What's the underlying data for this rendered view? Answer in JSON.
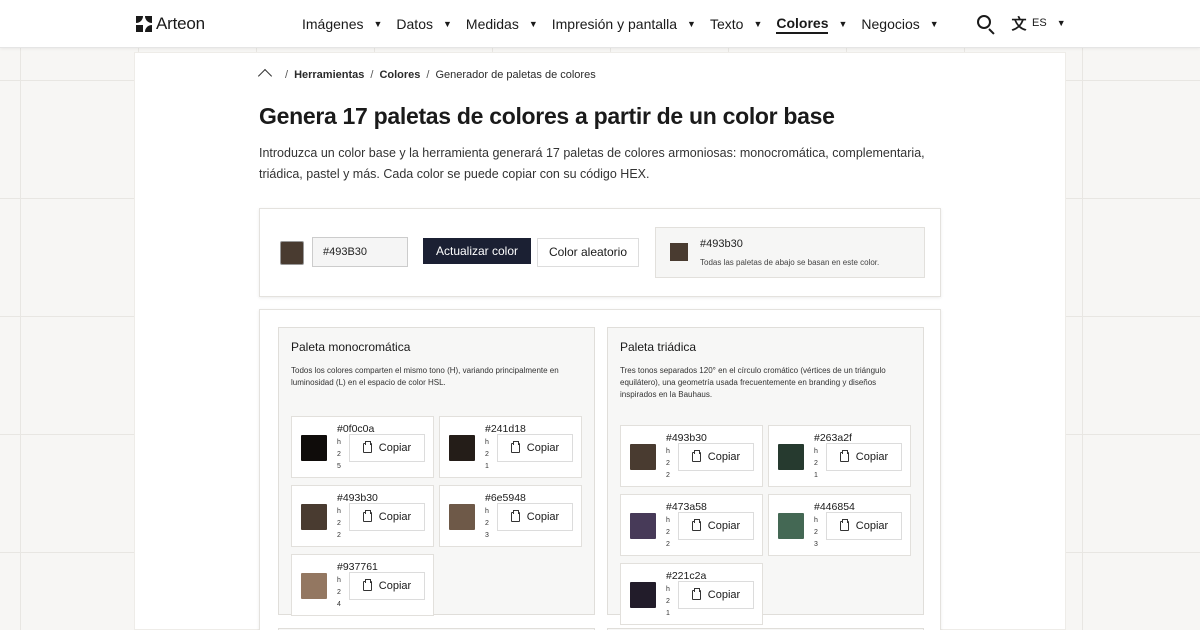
{
  "nav": {
    "brand": "Arteon",
    "menu": [
      {
        "label": "Imágenes",
        "active": false
      },
      {
        "label": "Datos",
        "active": false
      },
      {
        "label": "Medidas",
        "active": false
      },
      {
        "label": "Impresión y pantalla",
        "active": false
      },
      {
        "label": "Texto",
        "active": false
      },
      {
        "label": "Colores",
        "active": true
      },
      {
        "label": "Negocios",
        "active": false
      }
    ],
    "lang_code": "ES"
  },
  "breadcrumb": {
    "items": [
      "Herramientas",
      "Colores"
    ],
    "current": "Generador de paletas de colores"
  },
  "page": {
    "title": "Genera 17 paletas de colores a partir de un color base",
    "description": "Introduzca un color base y la herramienta generará 17 paletas de colores armoniosas: monocromática, complementaria, triádica, pastel y más. Cada color se puede copiar con su código HEX."
  },
  "controls": {
    "base_color": "#493b30",
    "hex_value": "#493B30",
    "update_label": "Actualizar color",
    "random_label": "Color aleatorio",
    "current_hex": "#493b30",
    "current_note": "Todas las paletas de abajo se basan en este color."
  },
  "copy_label": "Copiar",
  "palettes": [
    {
      "title": "Paleta monocromática",
      "description": "Todos los colores comparten el mismo tono (H), variando principalmente en luminosidad (L) en el espacio de color HSL.",
      "colors": [
        {
          "hex": "#0f0c0a",
          "meta": [
            "h",
            "2",
            "5"
          ]
        },
        {
          "hex": "#241d18",
          "meta": [
            "h",
            "2",
            "1"
          ]
        },
        {
          "hex": "#493b30",
          "meta": [
            "h",
            "2",
            "2"
          ]
        },
        {
          "hex": "#6e5948",
          "meta": [
            "h",
            "2",
            "3"
          ]
        },
        {
          "hex": "#937761",
          "meta": [
            "h",
            "2",
            "4"
          ]
        }
      ]
    },
    {
      "title": "Paleta triádica",
      "description": "Tres tonos separados 120° en el círculo cromático (vértices de un triángulo equilátero), una geometría usada frecuentemente en branding y diseños inspirados en la Bauhaus.",
      "colors": [
        {
          "hex": "#493b30",
          "meta": [
            "h",
            "2",
            "2"
          ]
        },
        {
          "hex": "#263a2f",
          "meta": [
            "h",
            "2",
            "1"
          ]
        },
        {
          "hex": "#473a58",
          "meta": [
            "h",
            "2",
            "2"
          ]
        },
        {
          "hex": "#446854",
          "meta": [
            "h",
            "2",
            "3"
          ]
        },
        {
          "hex": "#221c2a",
          "meta": [
            "h",
            "2",
            "1"
          ]
        }
      ]
    }
  ]
}
